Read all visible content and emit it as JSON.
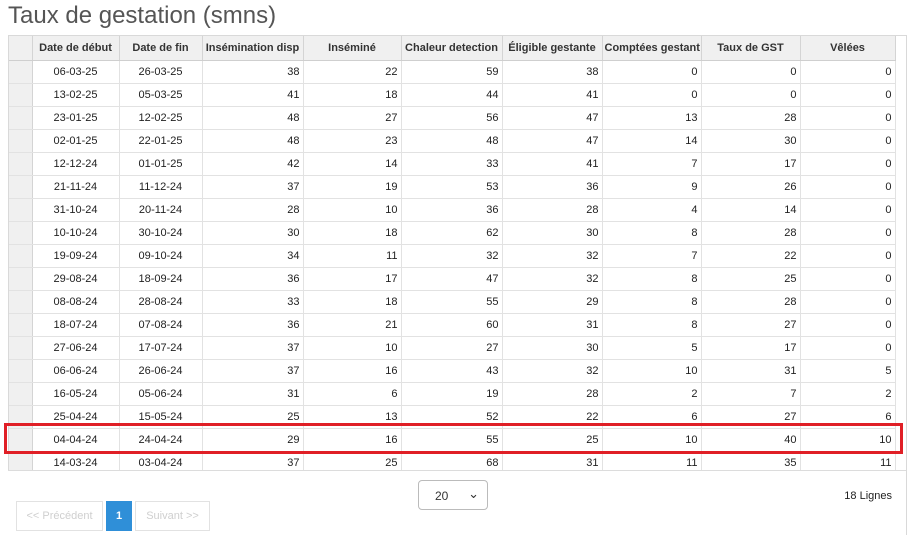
{
  "title": "Taux de gestation (smns)",
  "columns": [
    "Date de début",
    "Date de fin",
    "Insémination disp",
    "Inséminé",
    "Chaleur detection",
    "Éligible gestante",
    "Comptées gestant",
    "Taux de GST",
    "Vêlées"
  ],
  "rows": [
    [
      "06-03-25",
      "26-03-25",
      "38",
      "22",
      "59",
      "38",
      "0",
      "0",
      "0"
    ],
    [
      "13-02-25",
      "05-03-25",
      "41",
      "18",
      "44",
      "41",
      "0",
      "0",
      "0"
    ],
    [
      "23-01-25",
      "12-02-25",
      "48",
      "27",
      "56",
      "47",
      "13",
      "28",
      "0"
    ],
    [
      "02-01-25",
      "22-01-25",
      "48",
      "23",
      "48",
      "47",
      "14",
      "30",
      "0"
    ],
    [
      "12-12-24",
      "01-01-25",
      "42",
      "14",
      "33",
      "41",
      "7",
      "17",
      "0"
    ],
    [
      "21-11-24",
      "11-12-24",
      "37",
      "19",
      "53",
      "36",
      "9",
      "26",
      "0"
    ],
    [
      "31-10-24",
      "20-11-24",
      "28",
      "10",
      "36",
      "28",
      "4",
      "14",
      "0"
    ],
    [
      "10-10-24",
      "30-10-24",
      "30",
      "18",
      "62",
      "30",
      "8",
      "28",
      "0"
    ],
    [
      "19-09-24",
      "09-10-24",
      "34",
      "11",
      "32",
      "32",
      "7",
      "22",
      "0"
    ],
    [
      "29-08-24",
      "18-09-24",
      "36",
      "17",
      "47",
      "32",
      "8",
      "25",
      "0"
    ],
    [
      "08-08-24",
      "28-08-24",
      "33",
      "18",
      "55",
      "29",
      "8",
      "28",
      "0"
    ],
    [
      "18-07-24",
      "07-08-24",
      "36",
      "21",
      "60",
      "31",
      "8",
      "27",
      "0"
    ],
    [
      "27-06-24",
      "17-07-24",
      "37",
      "10",
      "27",
      "30",
      "5",
      "17",
      "0"
    ],
    [
      "06-06-24",
      "26-06-24",
      "37",
      "16",
      "43",
      "32",
      "10",
      "31",
      "5"
    ],
    [
      "16-05-24",
      "05-06-24",
      "31",
      "6",
      "19",
      "28",
      "2",
      "7",
      "2"
    ],
    [
      "25-04-24",
      "15-05-24",
      "25",
      "13",
      "52",
      "22",
      "6",
      "27",
      "6"
    ],
    [
      "04-04-24",
      "24-04-24",
      "29",
      "16",
      "55",
      "25",
      "10",
      "40",
      "10"
    ],
    [
      "14-03-24",
      "03-04-24",
      "37",
      "25",
      "68",
      "31",
      "11",
      "35",
      "11"
    ]
  ],
  "highlighted_row": 16,
  "pagination": {
    "prev_label": "<< Précédent",
    "current_page": "1",
    "next_label": "Suivant >>",
    "page_size": "20",
    "row_count": "18 Lignes"
  },
  "colors": {
    "highlight": "#e01f26",
    "active_page": "#2f8fd8"
  }
}
